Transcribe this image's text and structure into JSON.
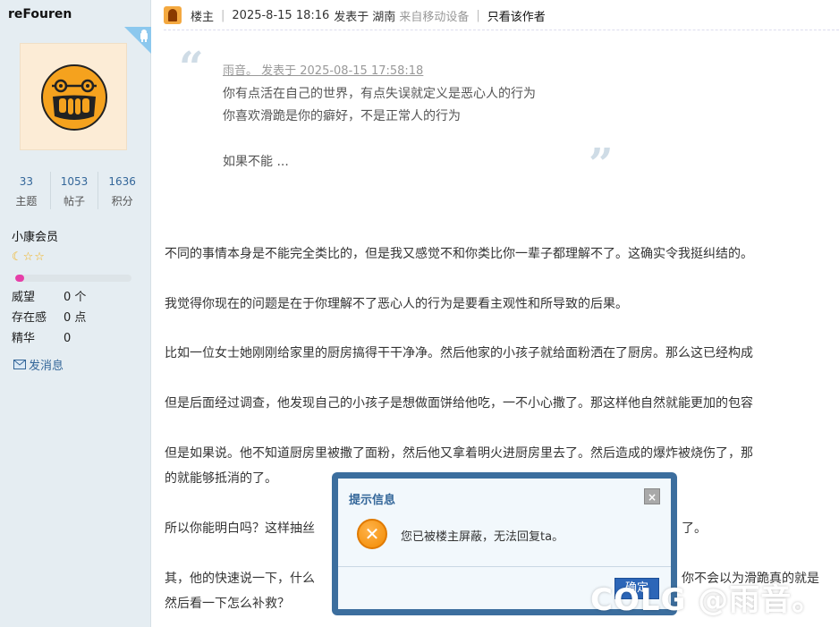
{
  "sidebar": {
    "username": "reFouren",
    "stats": [
      {
        "value": "33",
        "label": "主题"
      },
      {
        "value": "1053",
        "label": "帖子"
      },
      {
        "value": "1636",
        "label": "积分"
      }
    ],
    "group": "小康会员",
    "stars": "☾☆☆",
    "exp_progress_percent": 8,
    "props": [
      {
        "key": "威望",
        "value": "0 个"
      },
      {
        "key": "存在感",
        "value": "0 点"
      },
      {
        "key": "精华",
        "value": "0"
      }
    ],
    "pm_label": "发消息"
  },
  "header": {
    "role": "楼主",
    "datetime": "2025-8-15 18:16",
    "posted_at": "发表于",
    "location": "湖南",
    "device": "来自移动设备",
    "only_author": "只看该作者"
  },
  "quote": {
    "meta": "雨音。 发表于 2025-08-15 17:58:18",
    "lines": [
      "你有点活在自己的世界，有点失误就定义是恶心人的行为",
      "你喜欢滑跪是你的癖好，不是正常人的行为",
      "如果不能 ..."
    ]
  },
  "post": {
    "paragraphs": [
      "不同的事情本身是不能完全类比的，但是我又感觉不和你类比你一辈子都理解不了。这确实令我挺纠结的。",
      "我觉得你现在的问题是在于你理解不了恶心人的行为是要看主观性和所导致的后果。",
      "比如一位女士她刚刚给家里的厨房搞得干干净净。然后他家的小孩子就给面粉洒在了厨房。那么这已经构成",
      "但是后面经过调查，他发现自己的小孩子是想做面饼给他吃，一不小心撒了。那这样他自然就能更加的包容",
      "但是如果说。他不知道厨房里被撒了面粉，然后他又拿着明火进厨房里去了。然后造成的爆炸被烧伤了，那",
      "的就能够抵消的了。",
      "所以你能明白吗？这样抽丝",
      "了。",
      "其，他的快速说一下，什么",
      "你不会以为滑跪真的就是",
      "然后看一下怎么补救？"
    ]
  },
  "dialog": {
    "title": "提示信息",
    "close": "×",
    "message": "您已被楼主屏蔽，无法回复ta。",
    "ok": "确定"
  },
  "watermark": "COLG @雨音。",
  "colors": {
    "sidebar_bg": "#e5edf2",
    "link": "#336699",
    "dialog_border": "#3c6e9e",
    "ok_button": "#2c66b8",
    "exp_fill": "#e63fa8"
  }
}
